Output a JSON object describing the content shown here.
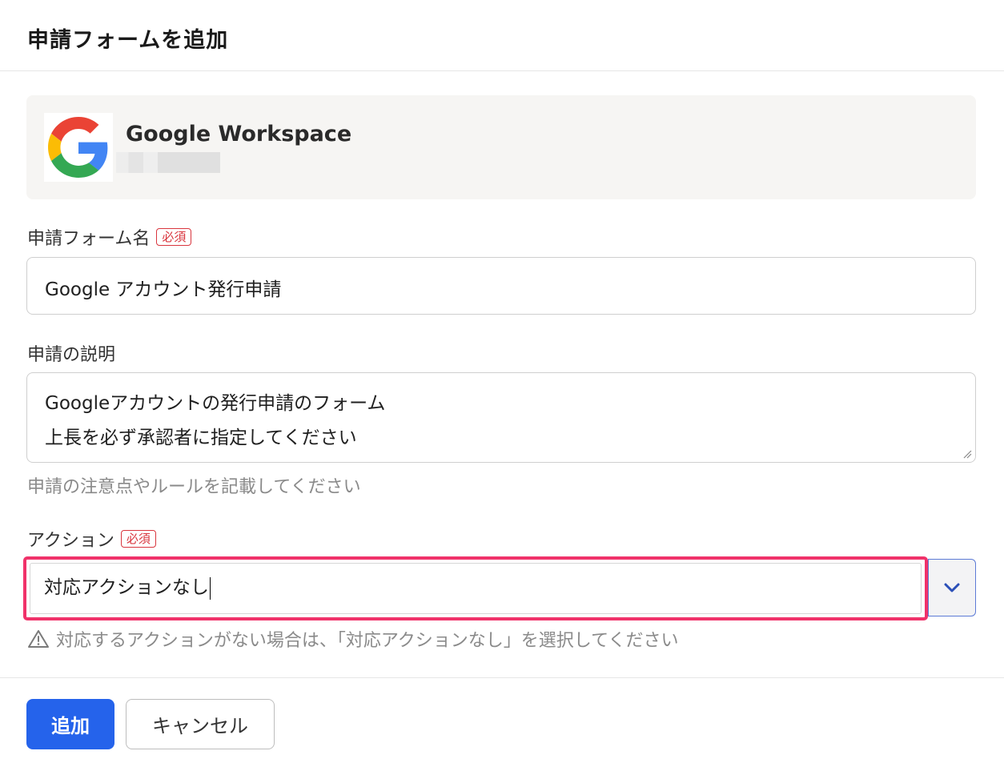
{
  "dialog": {
    "title": "申請フォームを追加"
  },
  "app": {
    "name": "Google Workspace",
    "subtitle_blurred": "",
    "logo_icon": "google-g-logo"
  },
  "form_name": {
    "label": "申請フォーム名",
    "required_badge": "必須",
    "value": "Google アカウント発行申請"
  },
  "description": {
    "label": "申請の説明",
    "lines": [
      "Googleアカウントの発行申請のフォーム",
      "上長を必ず承認者に指定してください"
    ],
    "helper": "申請の注意点やルールを記載してください"
  },
  "action": {
    "label": "アクション",
    "required_badge": "必須",
    "value": "対応アクションなし",
    "warning": "対応するアクションがない場合は、「対応アクションなし」を選択してください",
    "highlight_color": "#f0326a"
  },
  "buttons": {
    "submit": "追加",
    "cancel": "キャンセル"
  },
  "colors": {
    "primary": "#2563eb",
    "required": "#d9363e"
  }
}
